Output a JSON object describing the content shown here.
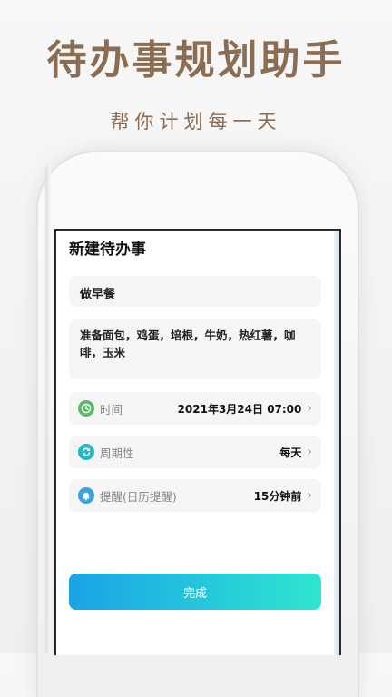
{
  "promo": {
    "title": "待办事规划助手",
    "subtitle": "帮你计划每一天"
  },
  "screen": {
    "page_title": "新建待办事",
    "title_field": {
      "value": "做早餐"
    },
    "notes_field": {
      "value": "准备面包，鸡蛋，培根，牛奶，热红薯，咖啡，玉米"
    },
    "rows": [
      {
        "icon": "clock-icon",
        "label": "时间",
        "value": "2021年3月24日 07:00",
        "icon_color": "#5cba6a"
      },
      {
        "icon": "repeat-icon",
        "label": "周期性",
        "value": "每天",
        "icon_color": "#22b9c7"
      },
      {
        "icon": "bell-icon",
        "label": "提醒(日历提醒)",
        "value": "15分钟前",
        "icon_color": "#3fa0e0"
      }
    ],
    "done_button": "完成"
  },
  "colors": {
    "brand_brown": "#8a6d52",
    "button_gradient_start": "#1aa3e8",
    "button_gradient_end": "#2fe6d0"
  }
}
